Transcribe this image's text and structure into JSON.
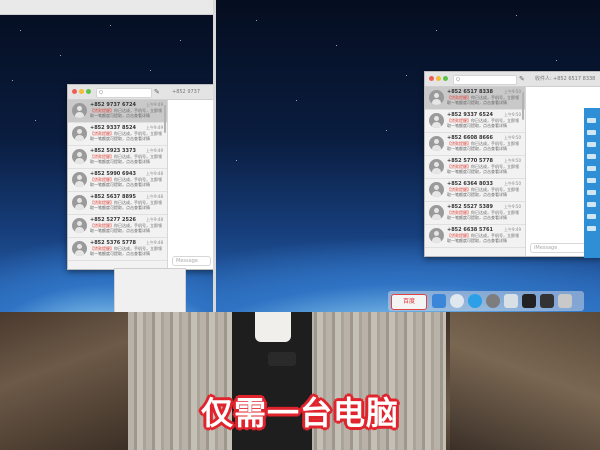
{
  "left_window": {
    "search_placeholder": "Q",
    "compose_icon": "compose-icon",
    "recipient": "+852 9737",
    "message_placeholder": "Message",
    "conversations": [
      {
        "number": "+852 9737 6724",
        "time": "上午9:49",
        "preview": "【贷款提醒】",
        "preview_rest": "你已达成，手机号，立即领取一笔额度可提取，点击查看详情",
        "selected": true
      },
      {
        "number": "+852 9337 8524",
        "time": "上午9:49",
        "preview": "【贷款提醒】",
        "preview_rest": "你已达成，手机号，立即领取一笔额度可提取，点击查看详情",
        "selected": false
      },
      {
        "number": "+852 5923 3373",
        "time": "上午9:49",
        "preview": "【贷款提醒】",
        "preview_rest": "你已达成，手机号，立即领取一笔额度可提取，点击查看详情",
        "selected": false
      },
      {
        "number": "+852 5990 6943",
        "time": "上午9:48",
        "preview": "【贷款提醒】",
        "preview_rest": "你已达成，手机号，立即领取一笔额度可提取，点击查看详情",
        "selected": false
      },
      {
        "number": "+852 5637 8895",
        "time": "上午9:48",
        "preview": "【贷款提醒】",
        "preview_rest": "你已达成，手机号，立即领取一笔额度可提取，点击查看详情",
        "selected": false
      },
      {
        "number": "+852 5277 2526",
        "time": "上午9:48",
        "preview": "【贷款提醒】",
        "preview_rest": "你已达成，手机号，立即领取一笔额度可提取，点击查看详情",
        "selected": false
      },
      {
        "number": "+852 5376 5778",
        "time": "上午9:48",
        "preview": "【贷款提醒】",
        "preview_rest": "你已达成，手机号，立即领取一笔额度可提取，点击查看详情",
        "selected": false
      }
    ]
  },
  "right_window": {
    "search_placeholder": "Q",
    "compose_icon": "compose-icon",
    "recipient_label": "收件人:",
    "recipient": "+852 6517 8338",
    "message_placeholder": "iMessage",
    "conversations": [
      {
        "number": "+852 6517 8338",
        "time": "上午9:50",
        "preview": "【贷款提醒】",
        "preview_rest": "你已达成，手机号，立即领取一笔额度可提取，点击查看详情",
        "selected": true
      },
      {
        "number": "+852 9337 6524",
        "time": "上午9:50",
        "preview": "【贷款提醒】",
        "preview_rest": "你已达成，手机号，立即领取一笔额度可提取，点击查看详情",
        "selected": false
      },
      {
        "number": "+852 6608 8666",
        "time": "上午9:50",
        "preview": "【贷款提醒】",
        "preview_rest": "你已达成，手机号，立即领取一笔额度可提取，点击查看详情",
        "selected": false
      },
      {
        "number": "+852 5770 5778",
        "time": "上午9:50",
        "preview": "【贷款提醒】",
        "preview_rest": "你已达成，手机号，立即领取一笔额度可提取，点击查看详情",
        "selected": false
      },
      {
        "number": "+852 6364 8033",
        "time": "上午9:50",
        "preview": "【贷款提醒】",
        "preview_rest": "你已达成，手机号，立即领取一笔额度可提取，点击查看详情",
        "selected": false
      },
      {
        "number": "+852 5527 5389",
        "time": "上午9:50",
        "preview": "【贷款提醒】",
        "preview_rest": "你已达成，手机号，立即领取一笔额度可提取，点击查看详情",
        "selected": false
      },
      {
        "number": "+852 6638 5761",
        "time": "上午9:49",
        "preview": "【贷款提醒】",
        "preview_rest": "你已达成，手机号，立即领取一笔额度可提取，点击查看详情",
        "selected": false
      }
    ]
  },
  "dock": {
    "items": [
      "baidu-input-icon",
      "finder-icon",
      "safari-icon",
      "settings-icon",
      "terminal-icon",
      "activity-icon",
      "app-icon",
      "app-icon"
    ],
    "baidu_label": "百度"
  },
  "caption": "仅需一台电脑",
  "colors": {
    "accent_red": "#e0463c",
    "caption_stroke": "#e0232c"
  }
}
